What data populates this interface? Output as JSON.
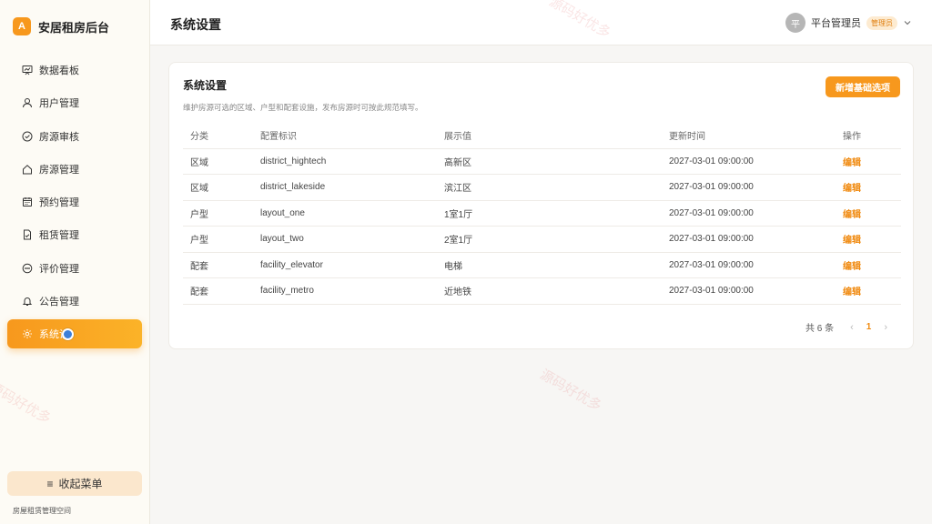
{
  "sidebar": {
    "logo_letter": "A",
    "brand": "安居租房后台",
    "items": [
      {
        "label": "数据看板",
        "icon": "dashboard-icon"
      },
      {
        "label": "用户管理",
        "icon": "user-icon"
      },
      {
        "label": "房源审核",
        "icon": "check-circle-icon"
      },
      {
        "label": "房源管理",
        "icon": "house-icon"
      },
      {
        "label": "预约管理",
        "icon": "calendar-icon"
      },
      {
        "label": "租赁管理",
        "icon": "document-icon"
      },
      {
        "label": "评价管理",
        "icon": "comment-icon"
      },
      {
        "label": "公告管理",
        "icon": "bell-icon"
      },
      {
        "label": "系统设",
        "icon": "gear-icon",
        "active": true
      }
    ],
    "collapse_label": "收起菜单",
    "footer": "房屋租赁管理空间"
  },
  "header": {
    "title": "系统设置",
    "avatar_text": "平",
    "user_name": "平台管理员",
    "role": "管理员"
  },
  "card": {
    "title": "系统设置",
    "description": "维护房源可选的区域、户型和配套设施，发布房源时可按此规范填写。",
    "add_button": "新增基础选项",
    "columns": [
      "分类",
      "配置标识",
      "展示值",
      "更新时间",
      "操作"
    ],
    "rows": [
      {
        "category": "区域",
        "key": "district_hightech",
        "value": "高新区",
        "updated": "2027-03-01 09:00:00",
        "action": "编辑"
      },
      {
        "category": "区域",
        "key": "district_lakeside",
        "value": "滨江区",
        "updated": "2027-03-01 09:00:00",
        "action": "编辑"
      },
      {
        "category": "户型",
        "key": "layout_one",
        "value": "1室1厅",
        "updated": "2027-03-01 09:00:00",
        "action": "编辑"
      },
      {
        "category": "户型",
        "key": "layout_two",
        "value": "2室1厅",
        "updated": "2027-03-01 09:00:00",
        "action": "编辑"
      },
      {
        "category": "配套",
        "key": "facility_elevator",
        "value": "电梯",
        "updated": "2027-03-01 09:00:00",
        "action": "编辑"
      },
      {
        "category": "配套",
        "key": "facility_metro",
        "value": "近地铁",
        "updated": "2027-03-01 09:00:00",
        "action": "编辑"
      }
    ],
    "pagination": {
      "total": "共 6 条",
      "prev": "‹",
      "page": "1",
      "next": "›"
    }
  },
  "watermark": "源码好优多",
  "colors": {
    "accent": "#f7981d",
    "link": "#f08a10"
  }
}
